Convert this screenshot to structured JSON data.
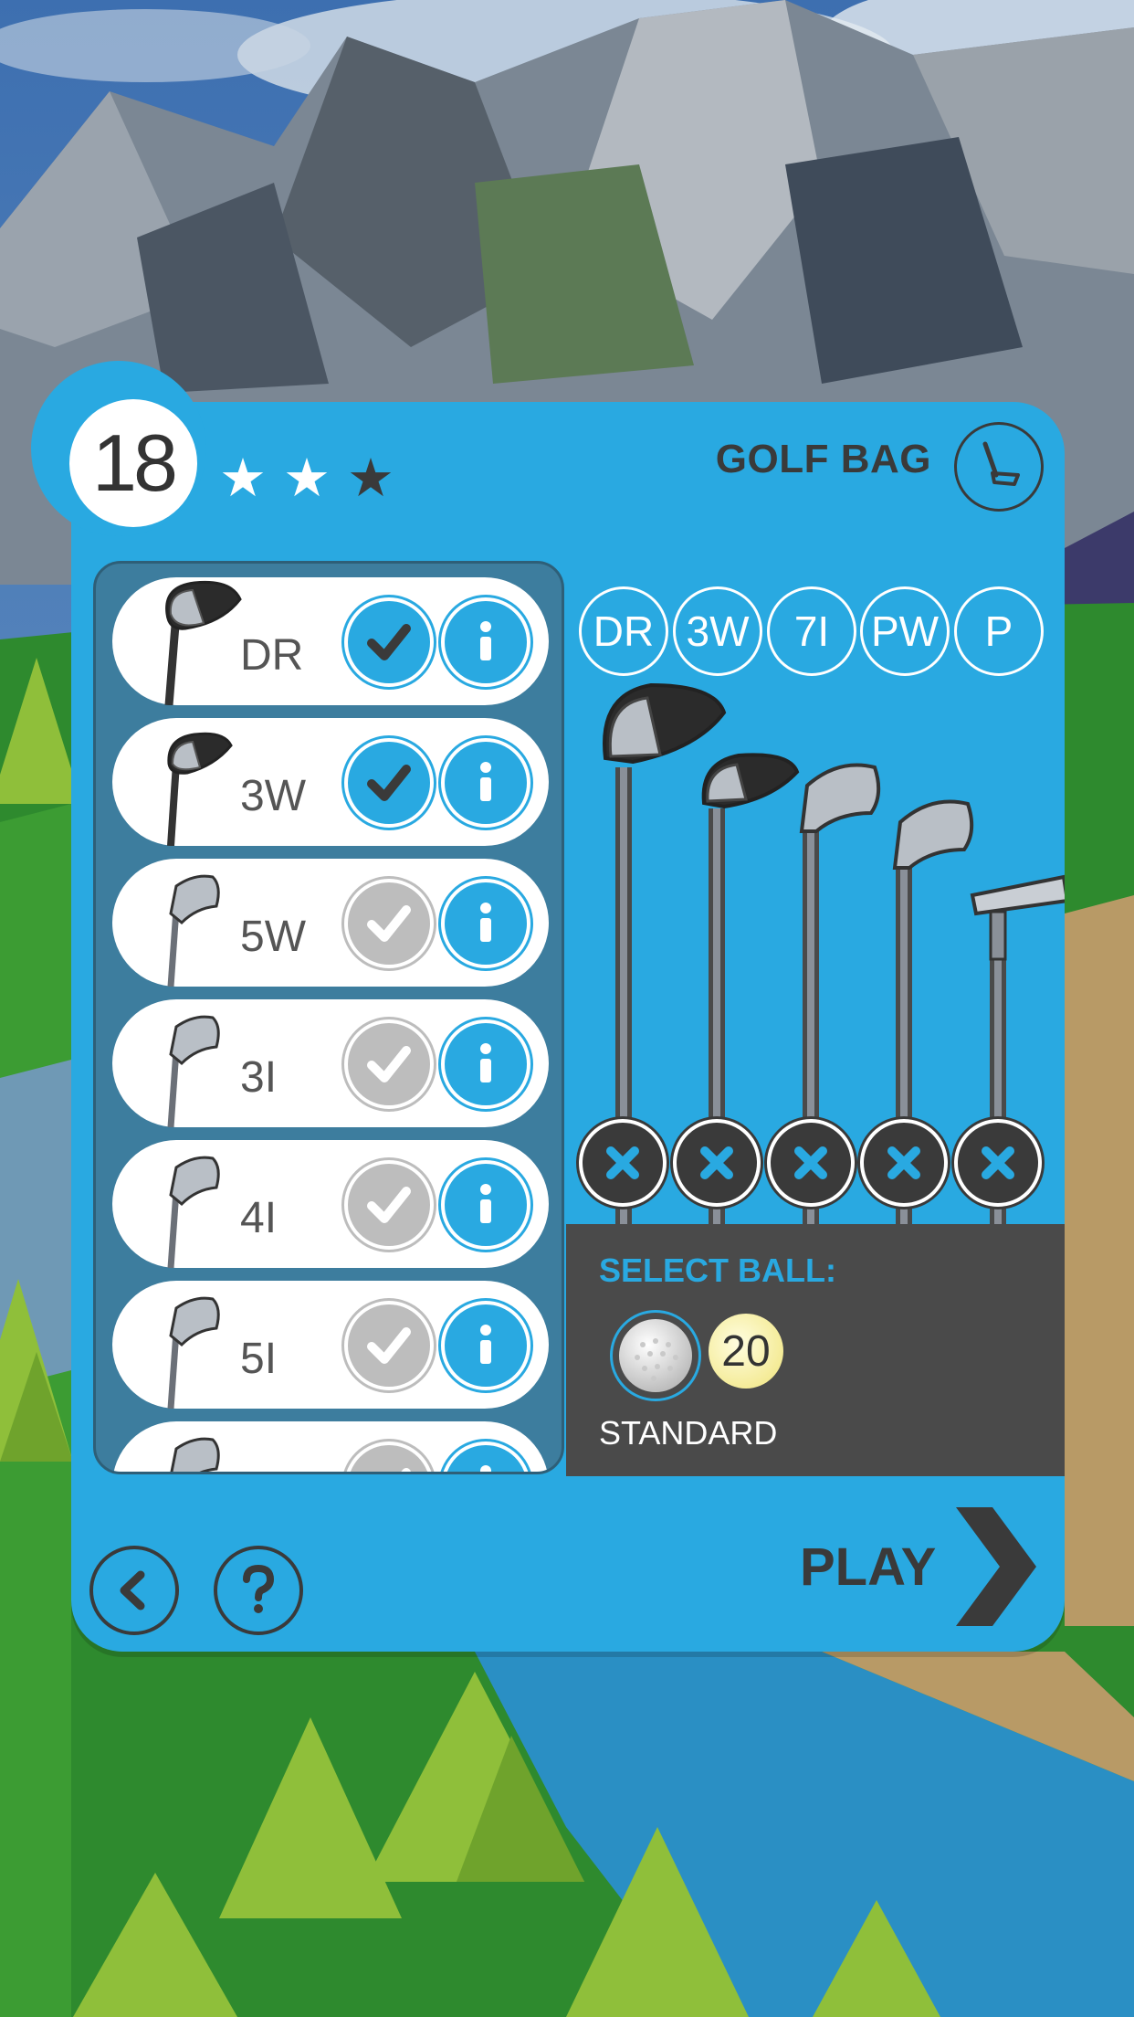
{
  "level": {
    "number": "18",
    "stars_earned": 2,
    "stars_total": 3
  },
  "header": {
    "title": "GOLF BAG",
    "icon": "golf-club-icon"
  },
  "club_list": [
    {
      "label": "DR",
      "selected": true,
      "type": "driver"
    },
    {
      "label": "3W",
      "selected": true,
      "type": "wood"
    },
    {
      "label": "5W",
      "selected": false,
      "type": "iron"
    },
    {
      "label": "3I",
      "selected": false,
      "type": "iron"
    },
    {
      "label": "4I",
      "selected": false,
      "type": "iron"
    },
    {
      "label": "5I",
      "selected": false,
      "type": "iron"
    },
    {
      "label": "",
      "selected": false,
      "type": "iron"
    }
  ],
  "bag": {
    "clubs": [
      {
        "label": "DR",
        "type": "driver"
      },
      {
        "label": "3W",
        "type": "wood"
      },
      {
        "label": "7I",
        "type": "iron"
      },
      {
        "label": "PW",
        "type": "wedge"
      },
      {
        "label": "P",
        "type": "putter"
      }
    ]
  },
  "ball": {
    "title": "SELECT BALL:",
    "count": "20",
    "name": "STANDARD"
  },
  "nav": {
    "back_icon": "back-arrow-icon",
    "help_icon": "question-mark-icon",
    "play_label": "PLAY"
  },
  "colors": {
    "accent": "#29a9e1",
    "dark": "#3a3a3a",
    "list_bg": "#3d7d9e"
  }
}
